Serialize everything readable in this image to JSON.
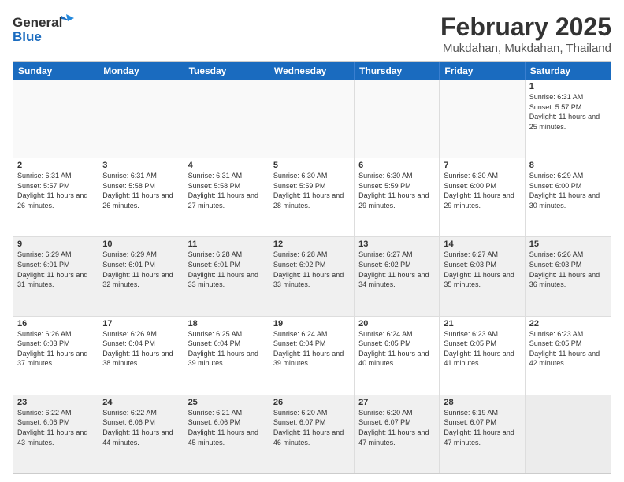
{
  "logo": {
    "general": "General",
    "blue": "Blue"
  },
  "header": {
    "month": "February 2025",
    "location": "Mukdahan, Mukdahan, Thailand"
  },
  "weekdays": [
    "Sunday",
    "Monday",
    "Tuesday",
    "Wednesday",
    "Thursday",
    "Friday",
    "Saturday"
  ],
  "rows": [
    {
      "alt": false,
      "cells": [
        {
          "day": "",
          "text": ""
        },
        {
          "day": "",
          "text": ""
        },
        {
          "day": "",
          "text": ""
        },
        {
          "day": "",
          "text": ""
        },
        {
          "day": "",
          "text": ""
        },
        {
          "day": "",
          "text": ""
        },
        {
          "day": "1",
          "text": "Sunrise: 6:31 AM\nSunset: 5:57 PM\nDaylight: 11 hours and 25 minutes."
        }
      ]
    },
    {
      "alt": false,
      "cells": [
        {
          "day": "2",
          "text": "Sunrise: 6:31 AM\nSunset: 5:57 PM\nDaylight: 11 hours and 26 minutes."
        },
        {
          "day": "3",
          "text": "Sunrise: 6:31 AM\nSunset: 5:58 PM\nDaylight: 11 hours and 26 minutes."
        },
        {
          "day": "4",
          "text": "Sunrise: 6:31 AM\nSunset: 5:58 PM\nDaylight: 11 hours and 27 minutes."
        },
        {
          "day": "5",
          "text": "Sunrise: 6:30 AM\nSunset: 5:59 PM\nDaylight: 11 hours and 28 minutes."
        },
        {
          "day": "6",
          "text": "Sunrise: 6:30 AM\nSunset: 5:59 PM\nDaylight: 11 hours and 29 minutes."
        },
        {
          "day": "7",
          "text": "Sunrise: 6:30 AM\nSunset: 6:00 PM\nDaylight: 11 hours and 29 minutes."
        },
        {
          "day": "8",
          "text": "Sunrise: 6:29 AM\nSunset: 6:00 PM\nDaylight: 11 hours and 30 minutes."
        }
      ]
    },
    {
      "alt": true,
      "cells": [
        {
          "day": "9",
          "text": "Sunrise: 6:29 AM\nSunset: 6:01 PM\nDaylight: 11 hours and 31 minutes."
        },
        {
          "day": "10",
          "text": "Sunrise: 6:29 AM\nSunset: 6:01 PM\nDaylight: 11 hours and 32 minutes."
        },
        {
          "day": "11",
          "text": "Sunrise: 6:28 AM\nSunset: 6:01 PM\nDaylight: 11 hours and 33 minutes."
        },
        {
          "day": "12",
          "text": "Sunrise: 6:28 AM\nSunset: 6:02 PM\nDaylight: 11 hours and 33 minutes."
        },
        {
          "day": "13",
          "text": "Sunrise: 6:27 AM\nSunset: 6:02 PM\nDaylight: 11 hours and 34 minutes."
        },
        {
          "day": "14",
          "text": "Sunrise: 6:27 AM\nSunset: 6:03 PM\nDaylight: 11 hours and 35 minutes."
        },
        {
          "day": "15",
          "text": "Sunrise: 6:26 AM\nSunset: 6:03 PM\nDaylight: 11 hours and 36 minutes."
        }
      ]
    },
    {
      "alt": false,
      "cells": [
        {
          "day": "16",
          "text": "Sunrise: 6:26 AM\nSunset: 6:03 PM\nDaylight: 11 hours and 37 minutes."
        },
        {
          "day": "17",
          "text": "Sunrise: 6:26 AM\nSunset: 6:04 PM\nDaylight: 11 hours and 38 minutes."
        },
        {
          "day": "18",
          "text": "Sunrise: 6:25 AM\nSunset: 6:04 PM\nDaylight: 11 hours and 39 minutes."
        },
        {
          "day": "19",
          "text": "Sunrise: 6:24 AM\nSunset: 6:04 PM\nDaylight: 11 hours and 39 minutes."
        },
        {
          "day": "20",
          "text": "Sunrise: 6:24 AM\nSunset: 6:05 PM\nDaylight: 11 hours and 40 minutes."
        },
        {
          "day": "21",
          "text": "Sunrise: 6:23 AM\nSunset: 6:05 PM\nDaylight: 11 hours and 41 minutes."
        },
        {
          "day": "22",
          "text": "Sunrise: 6:23 AM\nSunset: 6:05 PM\nDaylight: 11 hours and 42 minutes."
        }
      ]
    },
    {
      "alt": true,
      "cells": [
        {
          "day": "23",
          "text": "Sunrise: 6:22 AM\nSunset: 6:06 PM\nDaylight: 11 hours and 43 minutes."
        },
        {
          "day": "24",
          "text": "Sunrise: 6:22 AM\nSunset: 6:06 PM\nDaylight: 11 hours and 44 minutes."
        },
        {
          "day": "25",
          "text": "Sunrise: 6:21 AM\nSunset: 6:06 PM\nDaylight: 11 hours and 45 minutes."
        },
        {
          "day": "26",
          "text": "Sunrise: 6:20 AM\nSunset: 6:07 PM\nDaylight: 11 hours and 46 minutes."
        },
        {
          "day": "27",
          "text": "Sunrise: 6:20 AM\nSunset: 6:07 PM\nDaylight: 11 hours and 47 minutes."
        },
        {
          "day": "28",
          "text": "Sunrise: 6:19 AM\nSunset: 6:07 PM\nDaylight: 11 hours and 47 minutes."
        },
        {
          "day": "",
          "text": ""
        }
      ]
    }
  ]
}
